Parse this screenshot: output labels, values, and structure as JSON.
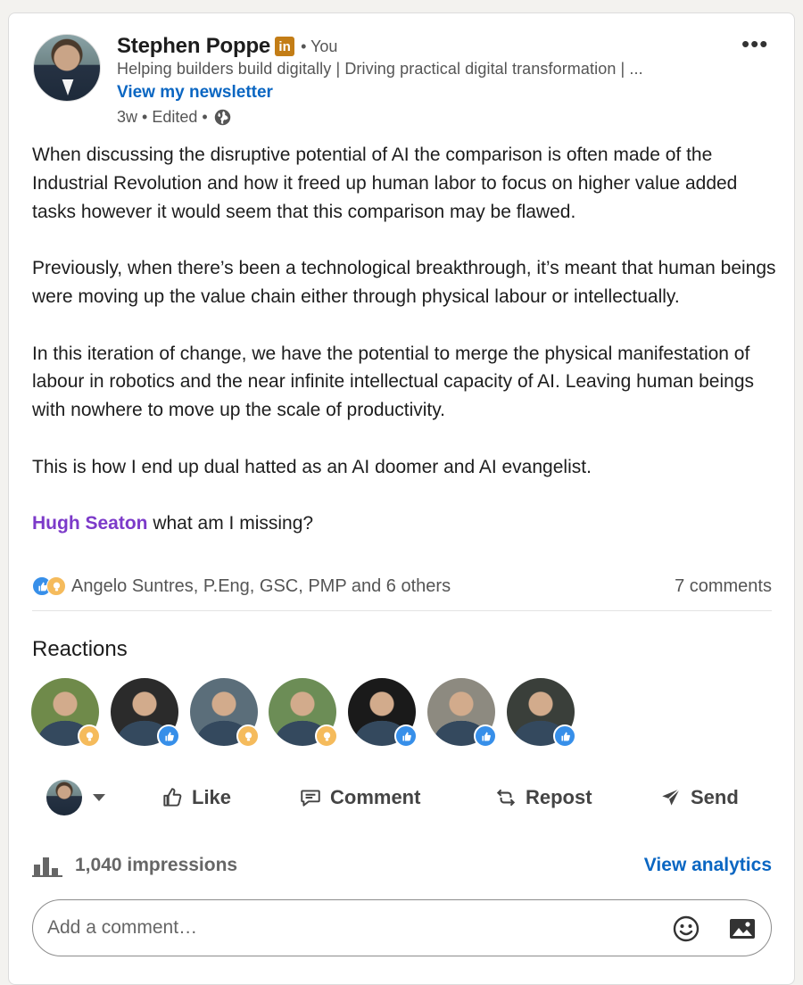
{
  "post": {
    "author": {
      "name": "Stephen Poppe",
      "badge": "in",
      "relation": "• You",
      "headline": "Helping builders build digitally | Driving practical digital transformation | ...",
      "newsletter_link": "View my newsletter",
      "time": "3w • Edited •"
    },
    "body": {
      "paragraphs": [
        "When discussing the disruptive potential of AI the comparison is often made of the Industrial Revolution and how it freed up human labor to focus on higher value added tasks however it would seem that this comparison may be flawed.",
        "Previously, when there’s been a technological breakthrough, it’s meant that human beings were moving up the value chain either through physical labour or intellectually.",
        "In this iteration of change, we have the potential to merge the physical manifestation of labour in robotics and the near infinite intellectual capacity of AI. Leaving human beings with nowhere to move up the scale of productivity.",
        "This is how I end up dual hatted as an AI doomer and AI evangelist."
      ],
      "mention": "Hugh Seaton",
      "mention_suffix": " what am I missing?"
    },
    "social_counts": {
      "reactors_summary": "Angelo Suntres, P.Eng, GSC, PMP and 6 others",
      "comments": "7 comments"
    },
    "reactions_title": "Reactions",
    "reactors": [
      {
        "reaction": "insightful",
        "bg": "#6f8a4a"
      },
      {
        "reaction": "like",
        "bg": "#2b2b2b"
      },
      {
        "reaction": "insightful",
        "bg": "#5b6e7a"
      },
      {
        "reaction": "insightful",
        "bg": "#6c8d56"
      },
      {
        "reaction": "like",
        "bg": "#1a1a1a"
      },
      {
        "reaction": "like",
        "bg": "#8d8a80"
      },
      {
        "reaction": "like",
        "bg": "#3a3f3a"
      }
    ],
    "actions": {
      "like": "Like",
      "comment": "Comment",
      "repost": "Repost",
      "send": "Send"
    },
    "impressions": "1,040 impressions",
    "view_analytics": "View analytics",
    "comment_placeholder": "Add a comment…"
  },
  "colors": {
    "link_blue": "#0a66c2",
    "mention_purple": "#7c3ac9",
    "like_blue": "#378fe9",
    "insight_yellow": "#f5bb5c"
  }
}
